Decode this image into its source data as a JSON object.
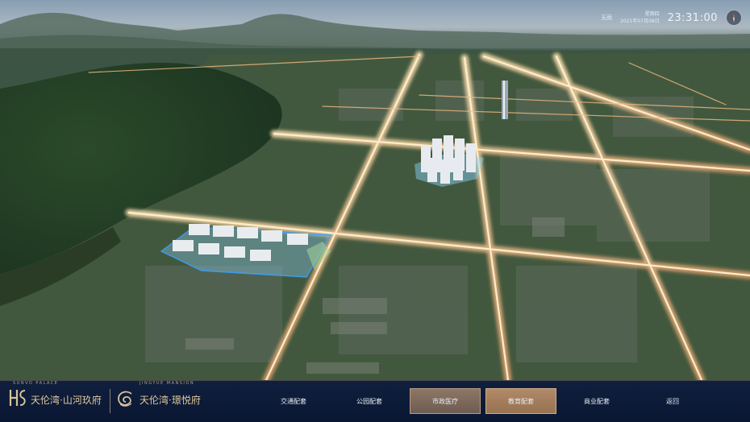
{
  "hud": {
    "weather": "无雨",
    "weekday": "星期四",
    "date": "2021年07月08日",
    "time": "23:31:00",
    "compass_icon": "compass-icon"
  },
  "brands": {
    "primary": {
      "english": "SUNVO PALACE",
      "chinese": "天伦湾·山河玖府",
      "icon": "sh-monogram-logo"
    },
    "secondary": {
      "english": "JINGYUE MANSION",
      "chinese": "天伦湾·璟悦府",
      "icon": "swirl-logo"
    }
  },
  "nav": {
    "items": [
      {
        "label": "交通配套",
        "state": "normal"
      },
      {
        "label": "公园配套",
        "state": "normal"
      },
      {
        "label": "市政医疗",
        "state": "active"
      },
      {
        "label": "教育配套",
        "state": "highlight"
      },
      {
        "label": "商业配套",
        "state": "normal"
      },
      {
        "label": "返回",
        "state": "normal"
      }
    ]
  },
  "colors": {
    "bar_bg": "#0f1f3d",
    "brand_gold": "#d9c29a",
    "tab_active": "#7e6a5c",
    "tab_highlight": "#a57e5c",
    "road_glow": "#f3c48a",
    "highlight_cyan": "#8ed8ff"
  }
}
